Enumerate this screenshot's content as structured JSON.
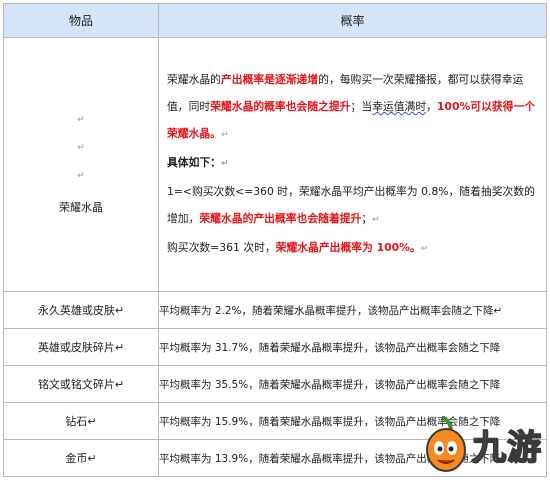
{
  "table": {
    "header": {
      "item": "物品",
      "probability": "概率"
    },
    "row_main": {
      "name": "荣耀水晶",
      "mark": "↵",
      "p1_a": "荣耀水晶的",
      "p1_b": "产出概率是逐渐递增",
      "p1_c": "的，每购买一次荣耀播报，都可以获得幸运值，同时",
      "p1_d": "荣耀水晶的概率也会随之提升",
      "p1_e": "；当",
      "p1_f": "幸运值满时",
      "p1_g": "，",
      "p1_h": "100%可以获得一个荣耀水晶。",
      "p2": "具体如下：",
      "p3_a": "1=<购买次数<=360 时，荣耀水晶平均产出概率为 0.8%，随着抽奖次数的增加，",
      "p3_b": "荣耀水晶的产出概率也会随着提升",
      "p3_c": "；",
      "p4_a": "购买次数=361 次时，",
      "p4_b": "荣耀水晶产出概率为 100%。"
    },
    "rows": [
      {
        "name": "永久英雄或皮肤↵",
        "desc": "平均概率为 2.2%，随着荣耀水晶概率提升，该物品产出概率会随之下降↵"
      },
      {
        "name": "英雄或皮肤碎片↵",
        "desc": "平均概率为 31.7%，随着荣耀水晶概率提升，该物品产出概率会随之下降"
      },
      {
        "name": "铭文或铭文碎片↵",
        "desc": "平均概率为 35.5%，随着荣耀水晶概率提升，该物品产出概率会随之下降"
      },
      {
        "name": "钻石↵",
        "desc": "平均概率为 15.9%，随着荣耀水晶概率提升，该物品产出概率会随之下降"
      },
      {
        "name": "金币↵",
        "desc": "平均概率为 13.9%，随着荣耀水晶概率提升，该物品产出概率会随之下降"
      }
    ]
  },
  "watermark": {
    "text": "九游",
    "logo_icon": "orange-mascot-icon"
  }
}
